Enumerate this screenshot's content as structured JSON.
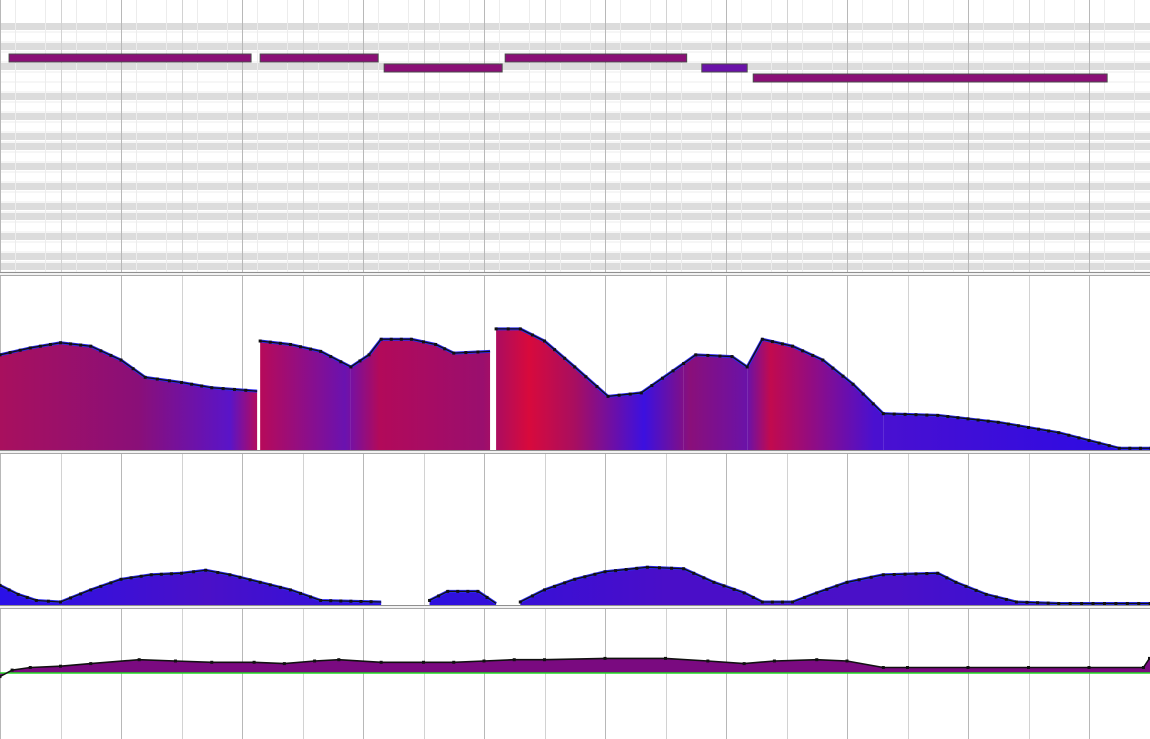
{
  "app": {
    "view": "piano-roll-editor"
  },
  "colors": {
    "note_fill": "#8a0f76",
    "note_fill_short": "#6a12a8",
    "note_stroke": "#4a4a4a",
    "grid_line": "#c8c8c8",
    "key_row_band": "#dcdcdc",
    "lane_divider": "#909090",
    "velocity_high": "#d80a3c",
    "velocity_low": "#2a0ae6",
    "mod_fill": "#2a10e2",
    "pitch_line": "#22d822",
    "pitch_fill": "#7a0a80",
    "envelope_line": "#111111",
    "envelope_edge": "#2a2aee"
  },
  "notes": [
    {
      "start": 0.15,
      "end": 4.15,
      "row": 2,
      "tone": "long"
    },
    {
      "start": 4.3,
      "end": 6.25,
      "row": 2,
      "tone": "long"
    },
    {
      "start": 6.35,
      "end": 8.3,
      "row": 3,
      "tone": "long"
    },
    {
      "start": 8.35,
      "end": 11.35,
      "row": 2,
      "tone": "long"
    },
    {
      "start": 11.6,
      "end": 12.35,
      "row": 3,
      "tone": "short"
    },
    {
      "start": 12.45,
      "end": 18.3,
      "row": 4,
      "tone": "long"
    }
  ],
  "velocity_segments": [
    {
      "points": [
        [
          0,
          0.55
        ],
        [
          0.5,
          0.59
        ],
        [
          1,
          0.62
        ],
        [
          1.5,
          0.6
        ],
        [
          2,
          0.52
        ],
        [
          2.4,
          0.42
        ],
        [
          3,
          0.39
        ],
        [
          3.5,
          0.36
        ],
        [
          4.25,
          0.34
        ]
      ]
    },
    {
      "points": [
        [
          4.3,
          0.63
        ],
        [
          4.8,
          0.61
        ],
        [
          5.3,
          0.57
        ],
        [
          5.8,
          0.48
        ]
      ]
    },
    {
      "points": [
        [
          5.8,
          0.48
        ],
        [
          6.1,
          0.55
        ],
        [
          6.3,
          0.64
        ],
        [
          6.8,
          0.64
        ],
        [
          7.2,
          0.61
        ],
        [
          7.5,
          0.56
        ],
        [
          8.1,
          0.57
        ]
      ]
    },
    {
      "points": [
        [
          8.2,
          0.7
        ],
        [
          8.6,
          0.7
        ],
        [
          9,
          0.63
        ],
        [
          9.5,
          0.48
        ],
        [
          10.05,
          0.31
        ],
        [
          10.6,
          0.33
        ],
        [
          11.3,
          0.5
        ]
      ]
    },
    {
      "points": [
        [
          11.3,
          0.5
        ],
        [
          11.5,
          0.55
        ],
        [
          12.1,
          0.54
        ],
        [
          12.35,
          0.48
        ]
      ]
    },
    {
      "points": [
        [
          12.35,
          0.48
        ],
        [
          12.6,
          0.64
        ],
        [
          13.1,
          0.6
        ],
        [
          13.6,
          0.52
        ],
        [
          14.1,
          0.38
        ],
        [
          14.6,
          0.21
        ]
      ]
    },
    {
      "points": [
        [
          14.6,
          0.21
        ],
        [
          15.5,
          0.2
        ],
        [
          16.5,
          0.16
        ],
        [
          17.5,
          0.1
        ],
        [
          18.5,
          0.01
        ]
      ]
    },
    {
      "points": [
        [
          18.5,
          0.01
        ],
        [
          19.2,
          0.01
        ]
      ]
    }
  ],
  "modulation_segments": [
    {
      "points": [
        [
          0,
          0.13
        ],
        [
          0.3,
          0.07
        ],
        [
          0.6,
          0.03
        ],
        [
          1,
          0.02
        ],
        [
          1.5,
          0.1
        ],
        [
          2,
          0.17
        ],
        [
          2.5,
          0.2
        ],
        [
          3,
          0.21
        ],
        [
          3.4,
          0.23
        ],
        [
          3.8,
          0.2
        ],
        [
          4.3,
          0.15
        ],
        [
          4.8,
          0.1
        ],
        [
          5.3,
          0.03
        ],
        [
          6.3,
          0.02
        ]
      ]
    },
    {
      "points": [
        [
          7.1,
          0.03
        ],
        [
          7.4,
          0.09
        ],
        [
          7.9,
          0.09
        ],
        [
          8.2,
          0.01
        ]
      ]
    },
    {
      "points": [
        [
          8.6,
          0.02
        ],
        [
          9,
          0.1
        ],
        [
          9.5,
          0.17
        ],
        [
          10,
          0.22
        ],
        [
          10.7,
          0.25
        ],
        [
          11.3,
          0.24
        ],
        [
          11.8,
          0.15
        ],
        [
          12.3,
          0.08
        ],
        [
          12.6,
          0.02
        ],
        [
          13.1,
          0.02
        ],
        [
          13.5,
          0.08
        ],
        [
          14,
          0.15
        ],
        [
          14.6,
          0.2
        ],
        [
          15.5,
          0.21
        ],
        [
          15.8,
          0.15
        ],
        [
          16.3,
          0.07
        ],
        [
          16.8,
          0.02
        ],
        [
          17.5,
          0.01
        ]
      ]
    },
    {
      "points": [
        [
          17.5,
          0.01
        ],
        [
          19.2,
          0.01
        ]
      ]
    }
  ],
  "pitch_points": [
    [
      0,
      0.48
    ],
    [
      0.2,
      0.53
    ],
    [
      0.5,
      0.55
    ],
    [
      1,
      0.56
    ],
    [
      1.5,
      0.58
    ],
    [
      2.3,
      0.61
    ],
    [
      2.9,
      0.6
    ],
    [
      3.5,
      0.59
    ],
    [
      4.2,
      0.59
    ],
    [
      4.7,
      0.58
    ],
    [
      5.2,
      0.6
    ],
    [
      5.6,
      0.61
    ],
    [
      6.3,
      0.59
    ],
    [
      7,
      0.59
    ],
    [
      7.5,
      0.59
    ],
    [
      8,
      0.6
    ],
    [
      8.5,
      0.61
    ],
    [
      9,
      0.61
    ],
    [
      10,
      0.62
    ],
    [
      11,
      0.62
    ],
    [
      11.7,
      0.6
    ],
    [
      12.3,
      0.58
    ],
    [
      12.8,
      0.6
    ],
    [
      13.5,
      0.61
    ],
    [
      14,
      0.6
    ],
    [
      14.6,
      0.55
    ],
    [
      15,
      0.55
    ],
    [
      16,
      0.55
    ],
    [
      17,
      0.55
    ],
    [
      18,
      0.55
    ],
    [
      18.9,
      0.55
    ],
    [
      19,
      0.62
    ],
    [
      19.2,
      0.62
    ]
  ]
}
